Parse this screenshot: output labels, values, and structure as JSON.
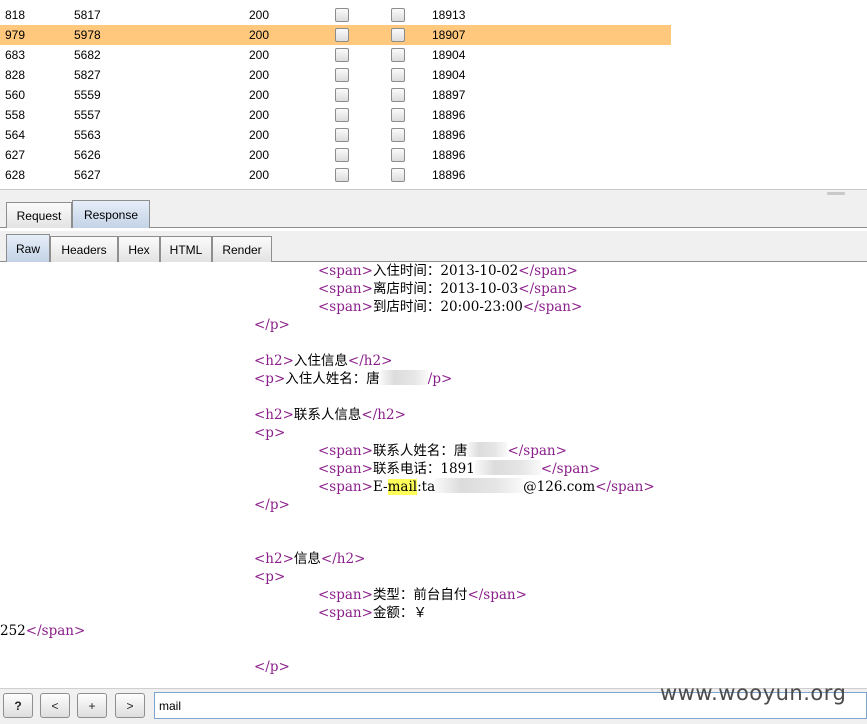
{
  "results": {
    "rows": [
      {
        "request": "818",
        "payload": "5817",
        "status": "200",
        "length": "18913",
        "selected": false
      },
      {
        "request": "979",
        "payload": "5978",
        "status": "200",
        "length": "18907",
        "selected": true
      },
      {
        "request": "683",
        "payload": "5682",
        "status": "200",
        "length": "18904",
        "selected": false
      },
      {
        "request": "828",
        "payload": "5827",
        "status": "200",
        "length": "18904",
        "selected": false
      },
      {
        "request": "560",
        "payload": "5559",
        "status": "200",
        "length": "18897",
        "selected": false
      },
      {
        "request": "558",
        "payload": "5557",
        "status": "200",
        "length": "18896",
        "selected": false
      },
      {
        "request": "564",
        "payload": "5563",
        "status": "200",
        "length": "18896",
        "selected": false
      },
      {
        "request": "627",
        "payload": "5626",
        "status": "200",
        "length": "18896",
        "selected": false
      },
      {
        "request": "628",
        "payload": "5627",
        "status": "200",
        "length": "18896",
        "selected": false
      }
    ]
  },
  "message_tabs": {
    "request": "Request",
    "response": "Response",
    "active": "response"
  },
  "view_tabs": {
    "raw": "Raw",
    "headers": "Headers",
    "hex": "Hex",
    "html": "HTML",
    "render": "Render",
    "active": "raw"
  },
  "raw": {
    "l1": {
      "open": "<span>",
      "text": "入住时间：2013-10-02",
      "close": "</span>"
    },
    "l2": {
      "open": "<span>",
      "text": "离店时间：2013-10-03",
      "close": "</span>"
    },
    "l3": {
      "open": "<span>",
      "text": "到店时间：20:00-23:00",
      "close": "</span>"
    },
    "l4": {
      "close": "</p>"
    },
    "l5": {
      "open": "<h2>",
      "text": "入住信息",
      "close": "</h2>"
    },
    "l6": {
      "open": "<p>",
      "text": "入住人姓名：唐",
      "close": "/p>"
    },
    "l7": {
      "open": "<h2>",
      "text": "联系人信息",
      "close": "</h2>"
    },
    "l8": {
      "open": "<p>"
    },
    "l9": {
      "open": "<span>",
      "text": "联系人姓名：唐",
      "close": "</span>"
    },
    "l10": {
      "open": "<span>",
      "text": "联系电话：1891",
      "close": "</span>"
    },
    "l11": {
      "open": "<span>",
      "pre": "E-",
      "match": "mail",
      "text": ":ta",
      "suffix": "@126.com",
      "close": "</span>"
    },
    "l12": {
      "close": "</p>"
    },
    "l13": {
      "open": "<h2>",
      "text": "信息",
      "close": "</h2>"
    },
    "l14": {
      "open": "<p>"
    },
    "l15": {
      "open": "<span>",
      "text": "类型：前台自付",
      "close": "</span>"
    },
    "l16": {
      "open": "<span>",
      "text": "金额：￥"
    },
    "l17": {
      "text": "252",
      "close": "</span>"
    },
    "l18": {
      "close": "</p>"
    }
  },
  "search": {
    "help_label": "?",
    "prev_label": "<",
    "add_label": "+",
    "next_label": ">",
    "query": "mail"
  },
  "watermark": "www.wooyun.org",
  "colors": {
    "selected_row": "#ffc87d",
    "tag": "#8a1e8a",
    "match_highlight": "#ffff5a"
  }
}
